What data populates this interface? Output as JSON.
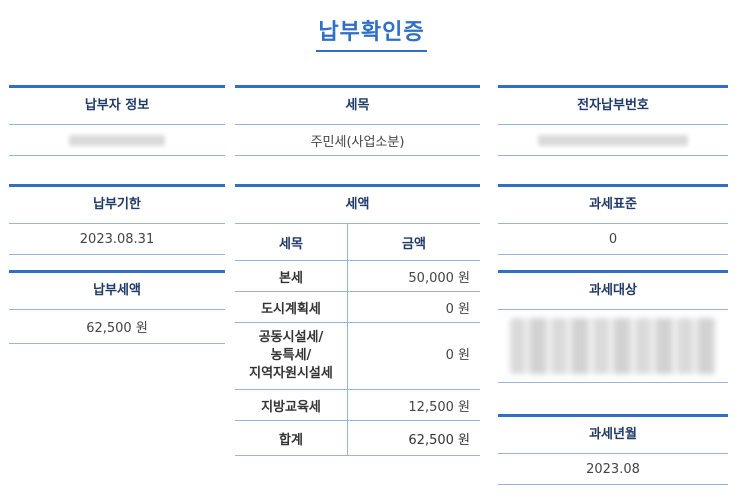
{
  "page_title": "납부확인증",
  "payer": {
    "label": "납부자 정보"
  },
  "tax_item": {
    "label": "세목",
    "value": "주민세(사업소분)"
  },
  "e_payment_no": {
    "label": "전자납부번호"
  },
  "due_date": {
    "label": "납부기한",
    "value": "2023.08.31"
  },
  "tax_amount_box": {
    "label": "세액",
    "columns": [
      "세목",
      "금액"
    ],
    "rows": [
      {
        "name": "본세",
        "amount": "50,000 원"
      },
      {
        "name": "도시계획세",
        "amount": "0 원"
      },
      {
        "name_lines": [
          "공동시설세/",
          "농특세/",
          "지역자원시설세"
        ],
        "amount": "0 원"
      },
      {
        "name": "지방교육세",
        "amount": "12,500 원"
      },
      {
        "name": "합계",
        "amount": "62,500 원"
      }
    ]
  },
  "paid_amount": {
    "label": "납부세액",
    "value": "62,500 원"
  },
  "tax_base": {
    "label": "과세표준",
    "value": "0"
  },
  "tax_object": {
    "label": "과세대상"
  },
  "tax_year_month": {
    "label": "과세년월",
    "value": "2023.08"
  },
  "colors": {
    "accent": "#2f6fc6",
    "heading": "#1f3a66",
    "divider": "#9bb3d6"
  }
}
